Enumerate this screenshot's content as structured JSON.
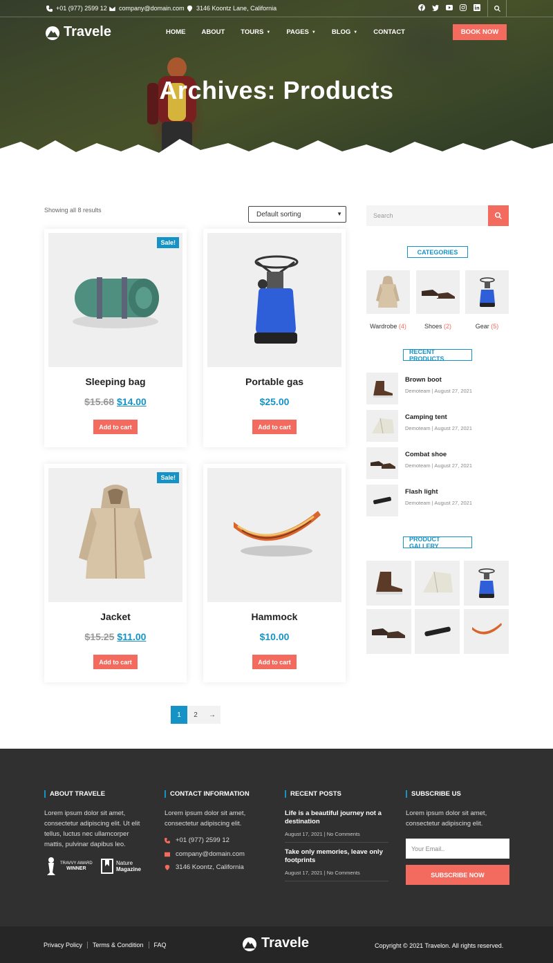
{
  "topbar": {
    "phone": "+01 (977) 2599 12",
    "email": "company@domain.com",
    "address": "3146 Koontz Lane, California",
    "socials": [
      "facebook-icon",
      "twitter-icon",
      "youtube-icon",
      "instagram-icon",
      "linkedin-icon"
    ]
  },
  "nav": {
    "logo": "Travele",
    "items": [
      {
        "label": "HOME",
        "caret": ""
      },
      {
        "label": "ABOUT",
        "caret": ""
      },
      {
        "label": "TOURS",
        "caret": "▼"
      },
      {
        "label": "PAGES",
        "caret": "▼"
      },
      {
        "label": "BLOG",
        "caret": "▼"
      },
      {
        "label": "CONTACT",
        "caret": ""
      }
    ],
    "book_label": "BOOK NOW"
  },
  "hero": {
    "title": "Archives: Products"
  },
  "shop": {
    "results_text": "Showing all 8 results",
    "sort_value": "Default sorting",
    "sale_badge": "Sale!",
    "add_to_cart": "Add to cart",
    "products": [
      {
        "name": "Sleeping bag",
        "old_price": "$15.68",
        "price": "$14.00",
        "on_sale": true
      },
      {
        "name": "Portable gas",
        "old_price": "",
        "price": "$25.00",
        "on_sale": false
      },
      {
        "name": "Jacket",
        "old_price": "$15.25",
        "price": "$11.00",
        "on_sale": true
      },
      {
        "name": "Hammock",
        "old_price": "",
        "price": "$10.00",
        "on_sale": false
      }
    ],
    "pagination": [
      "1",
      "2",
      "→"
    ]
  },
  "sidebar": {
    "search_placeholder": "Search",
    "categories_title": "CATEGORIES",
    "categories": [
      {
        "name": "Wardrobe",
        "count": "(4)"
      },
      {
        "name": "Shoes",
        "count": "(2)"
      },
      {
        "name": "Gear",
        "count": "(5)"
      }
    ],
    "recent_title": "RECENT PRODUCTS",
    "recent": [
      {
        "title": "Brown boot",
        "author": "Demoteam",
        "date": "August 27, 2021"
      },
      {
        "title": "Camping tent",
        "author": "Demoteam",
        "date": "August 27, 2021"
      },
      {
        "title": "Combat shoe",
        "author": "Demoteam",
        "date": "August 27, 2021"
      },
      {
        "title": "Flash light",
        "author": "Demoteam",
        "date": "August 27, 2021"
      }
    ],
    "gallery_title": "PRODUCT GALLERY"
  },
  "footer": {
    "about_title": "ABOUT TRAVELE",
    "about_text": "Lorem ipsum dolor sit amet, consectetur adipiscing elit. Ut elit tellus, luctus nec ullamcorper mattis, pulvinar dapibus leo.",
    "award_small": "TRAVVY AWARD",
    "award_big": "WINNER",
    "magazine_line1": "Nature",
    "magazine_line2": "Magazine",
    "contact_title": "CONTACT INFORMATION",
    "contact_text": "Lorem ipsum dolor sit amet, consectetur adipiscing elit.",
    "phone": "+01 (977) 2599 12",
    "email": "company@domain.com",
    "address": "3146 Koontz, California",
    "posts_title": "RECENT POSTS",
    "posts": [
      {
        "title": "Life is a beautiful journey not a destination",
        "date": "August 17, 2021",
        "comments": "No Comments"
      },
      {
        "title": "Take only memories, leave only footprints",
        "date": "August 17, 2021",
        "comments": "No Comments"
      }
    ],
    "subscribe_title": "SUBSCRIBE US",
    "subscribe_text": "Lorem ipsum dolor sit amet, consectetur adipiscing elit.",
    "email_placeholder": "Your Email..",
    "subscribe_button": "SUBSCRIBE NOW",
    "links": [
      "Privacy Policy",
      "Terms & Condition",
      "FAQ"
    ],
    "logo": "Travele",
    "copyright": "Copyright © 2021 Travelon. All rights reserved."
  },
  "colors": {
    "accent": "#f26b5e",
    "brand_blue": "#1693c6",
    "footer_bg": "#303030"
  }
}
